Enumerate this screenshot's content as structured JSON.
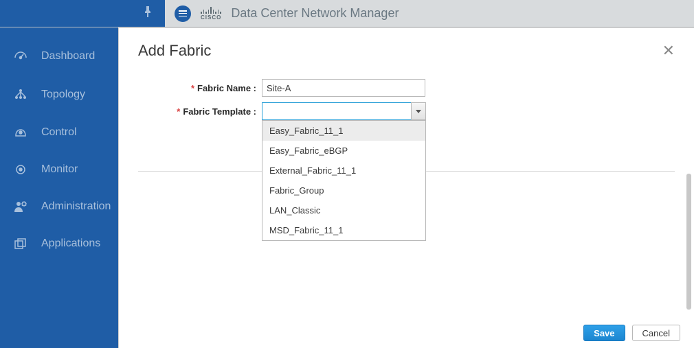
{
  "topbar": {
    "cisco_text": "CISCO",
    "app_title": "Data Center Network Manager"
  },
  "sidebar": {
    "items": [
      {
        "label": "Dashboard"
      },
      {
        "label": "Topology"
      },
      {
        "label": "Control"
      },
      {
        "label": "Monitor"
      },
      {
        "label": "Administration"
      },
      {
        "label": "Applications"
      }
    ]
  },
  "modal": {
    "title": "Add Fabric",
    "fabric_name_label": "Fabric Name :",
    "fabric_name_value": "Site-A",
    "fabric_template_label": "Fabric Template :",
    "fabric_template_value": "",
    "dropdown_options": [
      "Easy_Fabric_11_1",
      "Easy_Fabric_eBGP",
      "External_Fabric_11_1",
      "Fabric_Group",
      "LAN_Classic",
      "MSD_Fabric_11_1"
    ],
    "save_label": "Save",
    "cancel_label": "Cancel"
  }
}
